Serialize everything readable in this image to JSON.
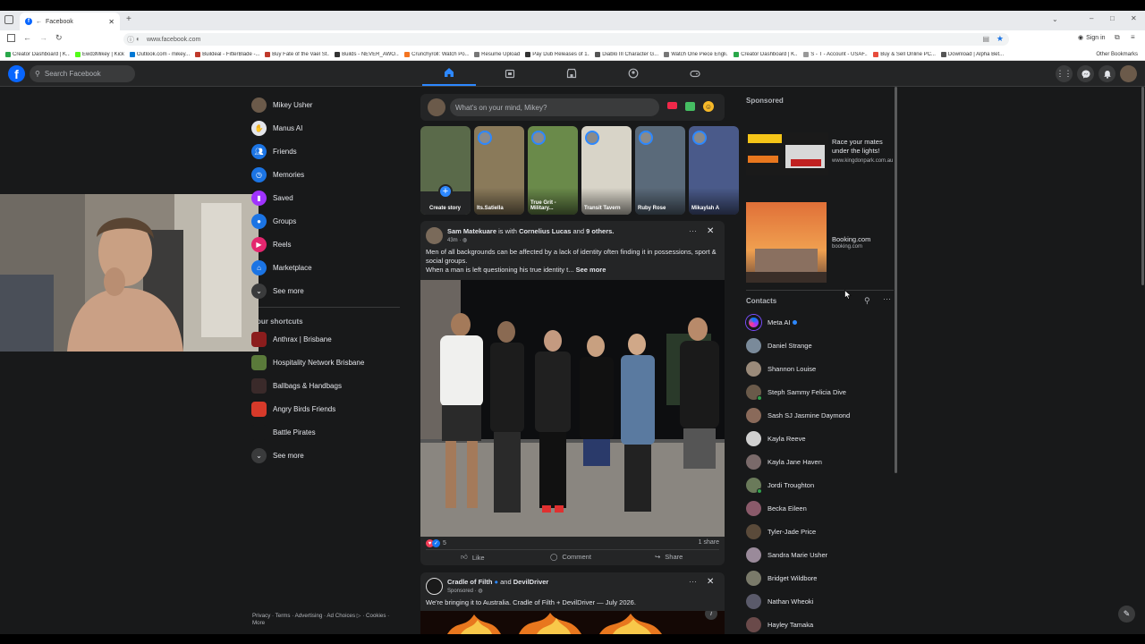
{
  "browser": {
    "tab_title": "Facebook",
    "url": "www.facebook.com",
    "signin_label": "Sign in",
    "other_bookmarks": "Other Bookmarks",
    "bookmarks": [
      {
        "label": "Creator Dashboard | K...",
        "color": "#2aa84a"
      },
      {
        "label": "Ewd3Mikey | Kick",
        "color": "#53fc18"
      },
      {
        "label": "Outlook.com - mikey...",
        "color": "#0078d4"
      },
      {
        "label": "Buildeal - FitterBlade -...",
        "color": "#c0392b"
      },
      {
        "label": "Buy Fate of the Vael St...",
        "color": "#c0392b"
      },
      {
        "label": "Builds - NEVER_AWO...",
        "color": "#333333"
      },
      {
        "label": "Crunchyroll: Watch Po...",
        "color": "#f47521"
      },
      {
        "label": "Resume Upload",
        "color": "#777777"
      },
      {
        "label": "Pay Dub Releases of 1...",
        "color": "#333333"
      },
      {
        "label": "Diablo III Character G...",
        "color": "#555555"
      },
      {
        "label": "Watch One Piece Engli...",
        "color": "#777777"
      },
      {
        "label": "Creator Dashboard | K...",
        "color": "#2aa84a"
      },
      {
        "label": "S - T - Account - USAF...",
        "color": "#999999"
      },
      {
        "label": "Buy & Sell Online PC...",
        "color": "#e74c3c"
      },
      {
        "label": "Download | Alpha Bet...",
        "color": "#555555"
      }
    ]
  },
  "header": {
    "search_placeholder": "Search Facebook"
  },
  "left_nav": {
    "items": [
      {
        "label": "Mikey Usher",
        "icon": "avatar",
        "color": "#6b5a4a"
      },
      {
        "label": "Manus AI",
        "icon": "manus-icon",
        "color": "#e4e6eb"
      },
      {
        "label": "Friends",
        "icon": "friends-icon",
        "color": "#1b74e4"
      },
      {
        "label": "Memories",
        "icon": "clock-icon",
        "color": "#1b74e4"
      },
      {
        "label": "Saved",
        "icon": "bookmark-icon",
        "color": "#a033ff"
      },
      {
        "label": "Groups",
        "icon": "groups-icon",
        "color": "#1b74e4"
      },
      {
        "label": "Reels",
        "icon": "reels-icon",
        "color": "#e4266e"
      },
      {
        "label": "Marketplace",
        "icon": "shop-icon",
        "color": "#1b74e4"
      },
      {
        "label": "See more",
        "icon": "chevron-down-icon",
        "color": "#3a3b3c"
      }
    ],
    "shortcuts_title": "our shortcuts",
    "shortcuts": [
      {
        "label": "Anthrax | Brisbane",
        "color": "#8b1d1d"
      },
      {
        "label": "Hospitality Network Brisbane",
        "color": "#5a7a3a"
      },
      {
        "label": "Ballbags & Handbags",
        "color": "#3a2a2a"
      },
      {
        "label": "Angry Birds Friends",
        "color": "#d73a2a"
      },
      {
        "label": "Battle Pirates",
        "color": "#18191a"
      },
      {
        "label": "See more",
        "color": "#3a3b3c"
      }
    ],
    "footer": "Privacy · Terms · Advertising · Ad Choices ▷ · Cookies · More"
  },
  "composer": {
    "placeholder": "What's on your mind, Mikey?"
  },
  "stories": [
    {
      "label": "Create story",
      "color": "#5a6a4a"
    },
    {
      "label": "Its.Satiella",
      "color": "#8a7a5a"
    },
    {
      "label": "True Grit - Military...",
      "color": "#6a8a4a"
    },
    {
      "label": "Transit Tavern",
      "color": "#d8d4c8"
    },
    {
      "label": "Ruby Rose",
      "color": "#5a6a7a"
    },
    {
      "label": "Mikaylah A",
      "color": "#4a5a8a"
    }
  ],
  "post1": {
    "author": "Sam Matekuare",
    "with_text": "is with",
    "tagged": "Cornelius Lucas",
    "and_text": "and",
    "others": "9 others.",
    "time": "43m · ",
    "text1": "Men of all backgrounds can be affected by a lack of identity often finding it in possessions, sport & social groups.",
    "text2": "When a man is left questioning his true identity t...",
    "see_more": "See more",
    "reactions": "5",
    "shares": "1 share",
    "like": "Like",
    "comment": "Comment",
    "share": "Share"
  },
  "post2": {
    "author": "Cradle of Filth",
    "and_text": "and",
    "author2": "DevilDriver",
    "sponsored": "Sponsored · ",
    "text": "We're bringing it to Australia. Cradle of Filth + DevilDriver — July 2026."
  },
  "sponsored": {
    "title": "Sponsored",
    "ads": [
      {
        "title": "Race your mates under the lights!",
        "domain": "www.kingdonpark.com.au"
      },
      {
        "title": "Booking.com",
        "domain": "booking.com"
      }
    ]
  },
  "contacts": {
    "title": "Contacts",
    "items": [
      {
        "name": "Meta AI",
        "color": "#7a4cff",
        "online": false
      },
      {
        "name": "Daniel Strange",
        "color": "#7a8a9a",
        "online": false
      },
      {
        "name": "Shannon Louise",
        "color": "#9a8a7a",
        "online": false
      },
      {
        "name": "Steph Sammy Felicia Dive",
        "color": "#6a5a4a",
        "online": true
      },
      {
        "name": "Sash SJ Jasmine Daymond",
        "color": "#8a6a5a",
        "online": false
      },
      {
        "name": "Kayla Reeve",
        "color": "#d0d0d0",
        "online": false
      },
      {
        "name": "Kayla Jane Haven",
        "color": "#7a6a6a",
        "online": false
      },
      {
        "name": "Jordi Troughton",
        "color": "#6a7a5a",
        "online": true
      },
      {
        "name": "Becka Eileen",
        "color": "#8a5a6a",
        "online": false
      },
      {
        "name": "Tyler-Jade Price",
        "color": "#5a4a3a",
        "online": false
      },
      {
        "name": "Sandra Marie Usher",
        "color": "#9a8a9a",
        "online": false
      },
      {
        "name": "Bridget Wildbore",
        "color": "#7a7a6a",
        "online": false
      },
      {
        "name": "Nathan Wheoki",
        "color": "#5a5a6a",
        "online": false
      },
      {
        "name": "Hayley Tamaka",
        "color": "#6a4a4a",
        "online": false
      }
    ]
  }
}
